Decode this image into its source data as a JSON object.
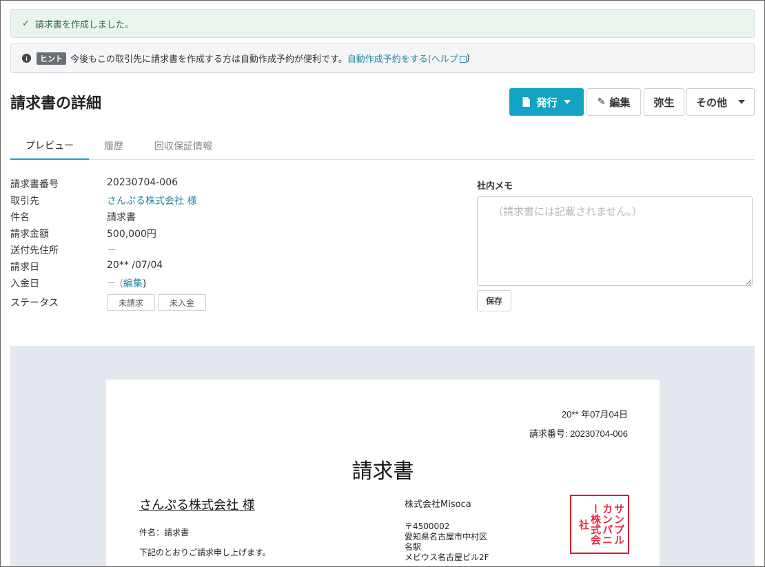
{
  "alerts": {
    "success_text": "請求書を作成しました。",
    "hint_badge": "ヒント",
    "hint_text": "今後もこの取引先に請求書を作成する方は自動作成予約が便利です。",
    "hint_link": "自動作成予約をする",
    "hint_help": "(ヘルプ",
    "hint_help_close": ")"
  },
  "header": {
    "title": "請求書の詳細",
    "issue_label": "発行",
    "edit_label": "編集",
    "yayoi_label": "弥生",
    "other_label": "その他"
  },
  "tabs": [
    "プレビュー",
    "履歴",
    "回収保証情報"
  ],
  "details": [
    {
      "label": "請求書番号",
      "value": "20230704-006"
    },
    {
      "label": "取引先",
      "value": "さんぷる株式会社 様"
    },
    {
      "label": "件名",
      "value": "請求書"
    },
    {
      "label": "請求金額",
      "value": "500,000円"
    },
    {
      "label": "送付先住所",
      "value": "－"
    },
    {
      "label": "請求日",
      "value": "20** /07/04"
    },
    {
      "label": "入金日",
      "value": "－ (",
      "edit": "編集",
      "close": ")"
    },
    {
      "label": "ステータス",
      "chips": [
        "未請求",
        "未入金"
      ]
    }
  ],
  "memo": {
    "label": "社内メモ",
    "placeholder": "（請求書には記載されません。）",
    "save_label": "保存"
  },
  "invoice": {
    "date": "20** 年07月04日",
    "number": "請求番号: 20230704-006",
    "title": "請求書",
    "client": "さんぷる株式会社 様",
    "subject": "件名：請求書",
    "message": "下記のとおりご請求申し上げます。",
    "company": "株式会社Misoca",
    "address": [
      "〒4500002",
      "愛知県名古屋市中村区",
      "名駅",
      "メビウス名古屋ビル2F"
    ],
    "seal_text": "サンプルカンパニー株式会社"
  },
  "colors": {
    "primary": "#13a3c4",
    "link": "#1f86a3",
    "success_bg": "#e8f4ec",
    "seal": "#e0192a"
  }
}
